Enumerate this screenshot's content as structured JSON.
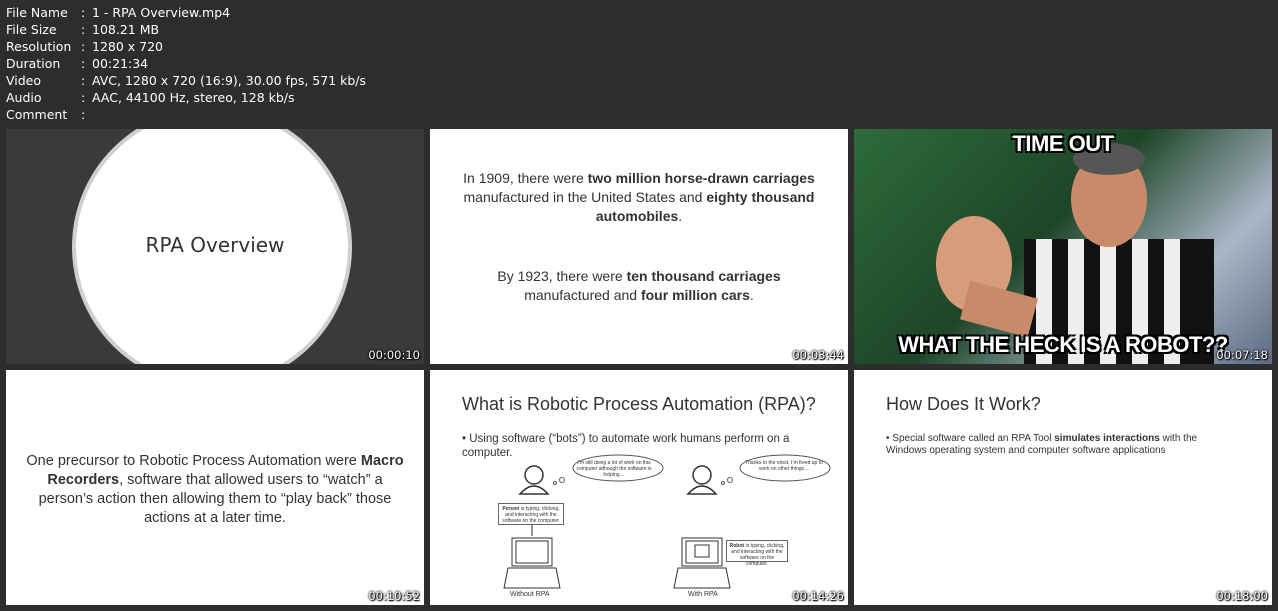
{
  "meta": [
    {
      "key": "File Name",
      "value": "1 - RPA Overview.mp4"
    },
    {
      "key": "File Size",
      "value": "108.21 MB"
    },
    {
      "key": "Resolution",
      "value": "1280 x 720"
    },
    {
      "key": "Duration",
      "value": "00:21:34"
    },
    {
      "key": "Video",
      "value": "AVC, 1280 x 720 (16:9), 30.00 fps, 571 kb/s"
    },
    {
      "key": "Audio",
      "value": "AAC, 44100 Hz, stereo, 128 kb/s"
    },
    {
      "key": "Comment",
      "value": ""
    }
  ],
  "separator": ":",
  "thumbs": [
    {
      "time": "00:00:10",
      "title": "RPA Overview"
    },
    {
      "time": "00:03:44",
      "p1a": "In 1909, there were ",
      "p1b": "two million horse-drawn carriages",
      "p1c": " manufactured in the United States and ",
      "p1d": "eighty thousand automobiles",
      "p1e": ".",
      "p2a": "By 1923, there were ",
      "p2b": "ten thousand carriages",
      "p2c": " manufactured and ",
      "p2d": "four million cars",
      "p2e": "."
    },
    {
      "time": "00:07:18",
      "top": "TIME OUT",
      "bottom": "WHAT THE HECK IS A ROBOT??"
    },
    {
      "time": "00:10:52",
      "a": "One precursor to Robotic Process Automation were ",
      "b": "Macro Recorders",
      "c": ", software that allowed users to “watch” a person’s action then allowing them to “play back” those actions at a later time."
    },
    {
      "time": "00:14:26",
      "heading": "What is Robotic Process Automation (RPA)?",
      "bullet": "• Using software (“bots”) to automate work humans perform on a computer.",
      "thought1": "I’m still doing a lot of work on this computer although the software is helping…",
      "thought2": "Thanks to the robot, I’m freed up to work on other things…",
      "box1a": "Person",
      "box1b": " is typing, clicking, and interacting with the software on the computer.",
      "box2a": "Robot",
      "box2b": " is typing, clicking, and interacting with the software on the computer.",
      "cap1": "Without RPA",
      "cap2": "With RPA"
    },
    {
      "time": "00:18:00",
      "heading": "How Does It Work?",
      "ba": "• Special software called an RPA Tool ",
      "bb": "simulates interactions",
      "bc": " with the Windows operating system and computer software applications"
    }
  ]
}
